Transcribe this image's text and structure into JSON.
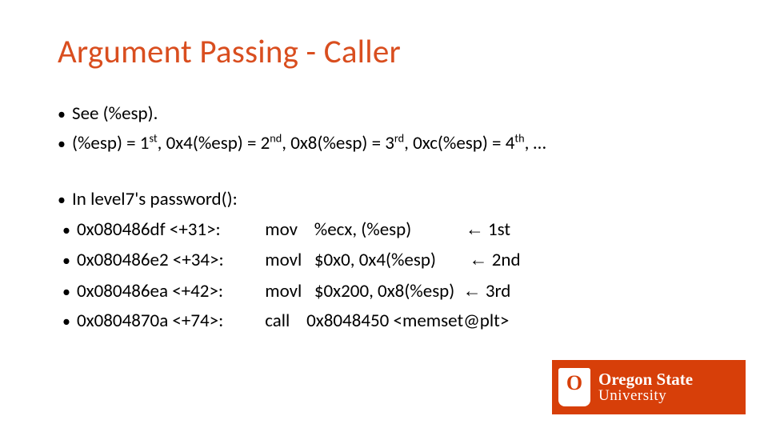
{
  "slide": {
    "title": "Argument Passing - Caller",
    "bullets": {
      "b1": "See (%esp).",
      "b2_pre": "(%esp) = 1",
      "b2_sup1": "st",
      "b2_mid1": ", 0x4(%esp) = 2",
      "b2_sup2": "nd",
      "b2_mid2": ", 0x8(%esp) = 3",
      "b2_sup3": "rd",
      "b2_mid3": ", 0xc(%esp) = 4",
      "b2_sup4": "th",
      "b2_end": ", …",
      "b3": "In level7's password():",
      "r1_addr": "0x080486df <+31>:",
      "r1_instr": "mov    %ecx, (%esp)            ",
      "r1_tail": " 1st",
      "r2_addr": "0x080486e2 <+34>:",
      "r2_instr": "movl   $0x0, 0x4(%esp)       ",
      "r2_tail": " 2nd",
      "r3_addr": "0x080486ea <+42>:",
      "r3_instr": "movl   $0x200, 0x8(%esp) ",
      "r3_tail": " 3rd",
      "r4_addr": "0x0804870a <+74>:",
      "r4_instr": "call    0x8048450 <memset@plt>"
    },
    "arrow": "←"
  },
  "logo": {
    "line1": "Oregon State",
    "line2": "University",
    "mark": "O"
  }
}
